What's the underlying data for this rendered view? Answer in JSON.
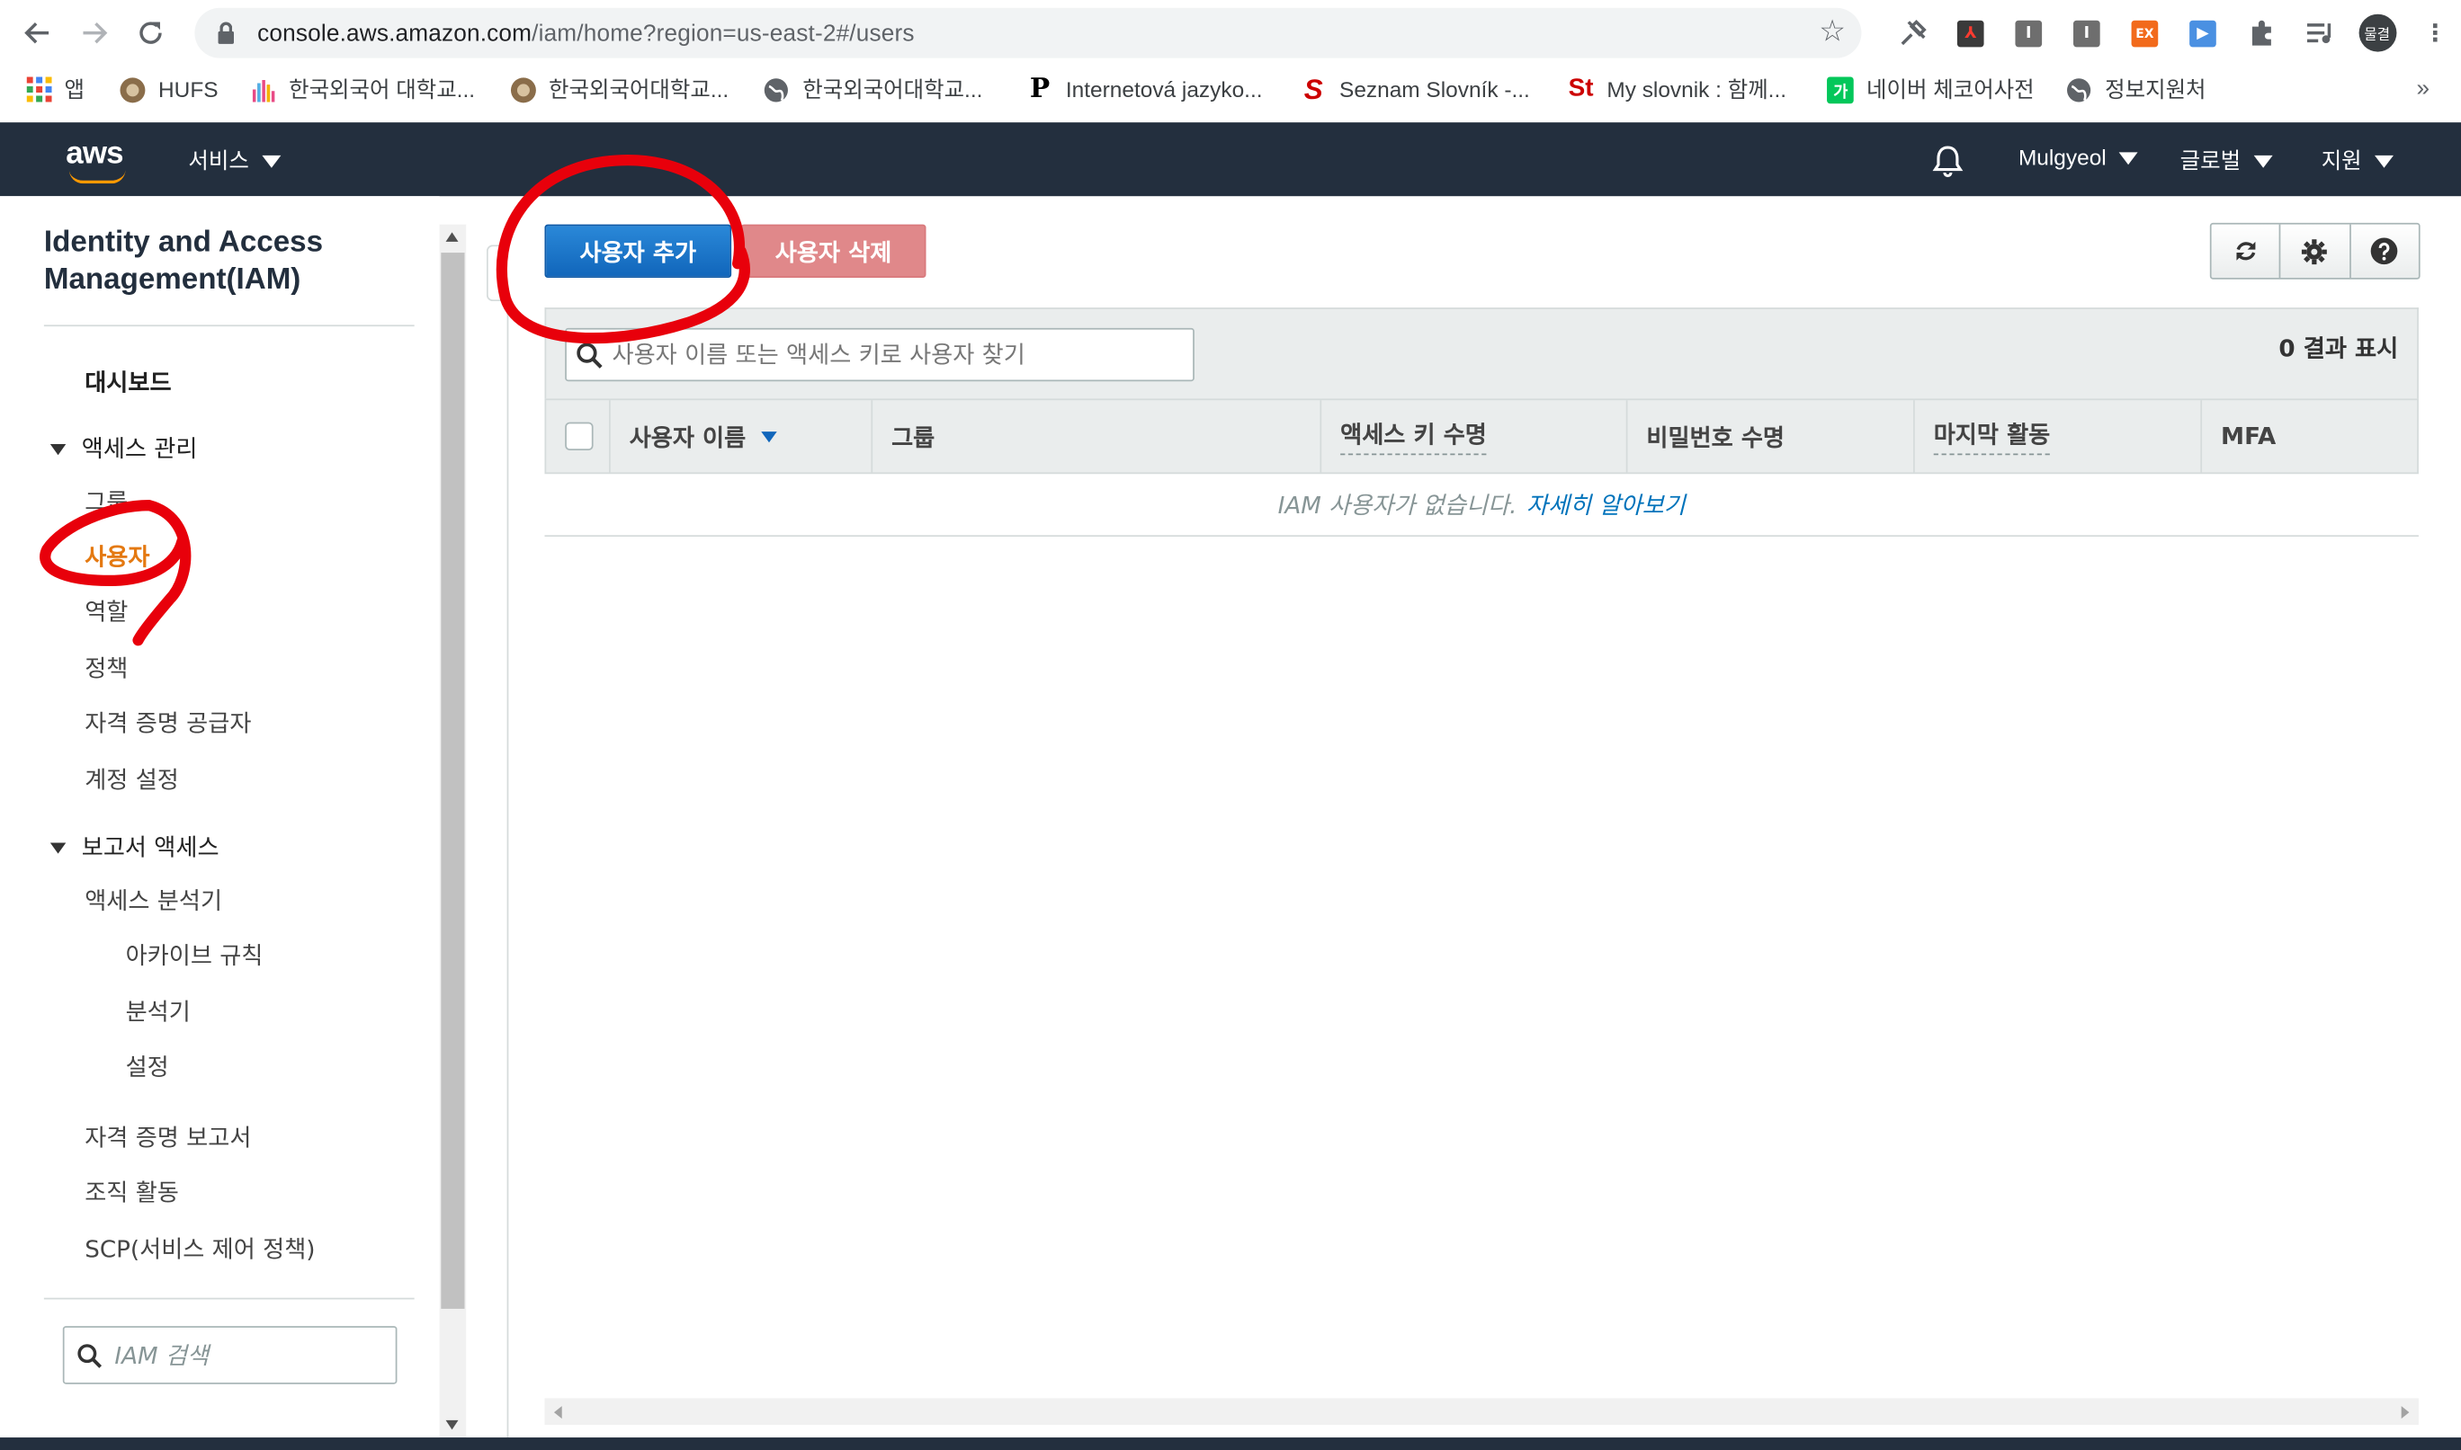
{
  "browser": {
    "url_host": "console.aws.amazon.com",
    "url_path": "/iam/home?region=us-east-2#/users",
    "bookmarks": [
      {
        "label": "앱",
        "icon": "apps-grid-icon"
      },
      {
        "label": "HUFS",
        "icon": "hufs-icon"
      },
      {
        "label": "한국외국어 대학교...",
        "icon": "hand-icon"
      },
      {
        "label": "한국외국어대학교...",
        "icon": "hufs-icon"
      },
      {
        "label": "한국외국어대학교...",
        "icon": "globe-icon"
      },
      {
        "label": "Internetová jazyko...",
        "icon": "p-icon"
      },
      {
        "label": "Seznam Slovník -...",
        "icon": "seznam-icon"
      },
      {
        "label": "My slovnik : 함께...",
        "icon": "slovnik-icon"
      },
      {
        "label": "네이버 체코어사전",
        "icon": "naver-dict-icon"
      },
      {
        "label": "정보지원처",
        "icon": "globe-icon"
      }
    ],
    "profile_label": "물결"
  },
  "aws_nav": {
    "logo": "aws",
    "services_label": "서비스",
    "user_label": "Mulgyeol",
    "region_label": "글로벌",
    "support_label": "지원"
  },
  "sidebar": {
    "title": "Identity and Access Management(IAM)",
    "dashboard": "대시보드",
    "access_mgmt_section": "액세스 관리",
    "access_items": {
      "groups": "그룹",
      "users": "사용자",
      "roles": "역할",
      "policies": "정책",
      "identity_providers": "자격 증명 공급자",
      "account_settings": "계정 설정"
    },
    "reports_section": "보고서 액세스",
    "report_items": {
      "access_analyzer": "액세스 분석기",
      "archive_rules": "아카이브 규칙",
      "analyzer": "분석기",
      "settings": "설정",
      "credential_report": "자격 증명 보고서",
      "org_activity": "조직 활동",
      "scp": "SCP(서비스 제어 정책)"
    },
    "search_placeholder": "IAM 검색"
  },
  "main": {
    "add_user_label": "사용자 추가",
    "delete_user_label": "사용자 삭제",
    "filter_placeholder": "사용자 이름 또는 액세스 키로 사용자 찾기",
    "result_count": "0 결과 표시",
    "columns": {
      "username": "사용자 이름",
      "groups": "그룹",
      "access_key_age": "액세스 키 수명",
      "password_age": "비밀번호 수명",
      "last_activity": "마지막 활동",
      "mfa": "MFA"
    },
    "empty_text": "IAM 사용자가 없습니다.",
    "learn_more": "자세히 알아보기"
  },
  "colors": {
    "aws_nav_bg": "#232f3e",
    "primary_button": "#1166bb",
    "active_link": "#e47911",
    "annotation_red": "#e8000b"
  }
}
